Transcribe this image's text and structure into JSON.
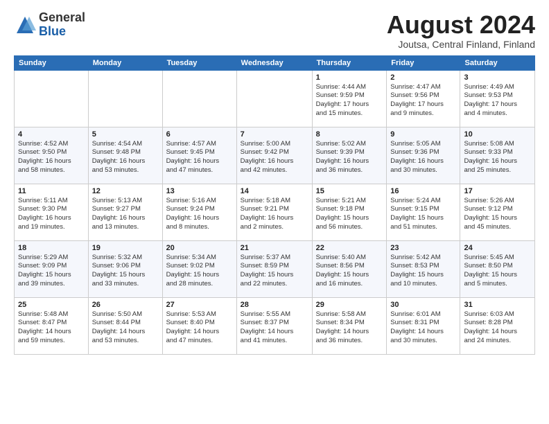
{
  "header": {
    "logo_general": "General",
    "logo_blue": "Blue",
    "month_title": "August 2024",
    "location": "Joutsa, Central Finland, Finland"
  },
  "days_of_week": [
    "Sunday",
    "Monday",
    "Tuesday",
    "Wednesday",
    "Thursday",
    "Friday",
    "Saturday"
  ],
  "weeks": [
    [
      {
        "day": "",
        "info": ""
      },
      {
        "day": "",
        "info": ""
      },
      {
        "day": "",
        "info": ""
      },
      {
        "day": "",
        "info": ""
      },
      {
        "day": "1",
        "info": "Sunrise: 4:44 AM\nSunset: 9:59 PM\nDaylight: 17 hours\nand 15 minutes."
      },
      {
        "day": "2",
        "info": "Sunrise: 4:47 AM\nSunset: 9:56 PM\nDaylight: 17 hours\nand 9 minutes."
      },
      {
        "day": "3",
        "info": "Sunrise: 4:49 AM\nSunset: 9:53 PM\nDaylight: 17 hours\nand 4 minutes."
      }
    ],
    [
      {
        "day": "4",
        "info": "Sunrise: 4:52 AM\nSunset: 9:50 PM\nDaylight: 16 hours\nand 58 minutes."
      },
      {
        "day": "5",
        "info": "Sunrise: 4:54 AM\nSunset: 9:48 PM\nDaylight: 16 hours\nand 53 minutes."
      },
      {
        "day": "6",
        "info": "Sunrise: 4:57 AM\nSunset: 9:45 PM\nDaylight: 16 hours\nand 47 minutes."
      },
      {
        "day": "7",
        "info": "Sunrise: 5:00 AM\nSunset: 9:42 PM\nDaylight: 16 hours\nand 42 minutes."
      },
      {
        "day": "8",
        "info": "Sunrise: 5:02 AM\nSunset: 9:39 PM\nDaylight: 16 hours\nand 36 minutes."
      },
      {
        "day": "9",
        "info": "Sunrise: 5:05 AM\nSunset: 9:36 PM\nDaylight: 16 hours\nand 30 minutes."
      },
      {
        "day": "10",
        "info": "Sunrise: 5:08 AM\nSunset: 9:33 PM\nDaylight: 16 hours\nand 25 minutes."
      }
    ],
    [
      {
        "day": "11",
        "info": "Sunrise: 5:11 AM\nSunset: 9:30 PM\nDaylight: 16 hours\nand 19 minutes."
      },
      {
        "day": "12",
        "info": "Sunrise: 5:13 AM\nSunset: 9:27 PM\nDaylight: 16 hours\nand 13 minutes."
      },
      {
        "day": "13",
        "info": "Sunrise: 5:16 AM\nSunset: 9:24 PM\nDaylight: 16 hours\nand 8 minutes."
      },
      {
        "day": "14",
        "info": "Sunrise: 5:18 AM\nSunset: 9:21 PM\nDaylight: 16 hours\nand 2 minutes."
      },
      {
        "day": "15",
        "info": "Sunrise: 5:21 AM\nSunset: 9:18 PM\nDaylight: 15 hours\nand 56 minutes."
      },
      {
        "day": "16",
        "info": "Sunrise: 5:24 AM\nSunset: 9:15 PM\nDaylight: 15 hours\nand 51 minutes."
      },
      {
        "day": "17",
        "info": "Sunrise: 5:26 AM\nSunset: 9:12 PM\nDaylight: 15 hours\nand 45 minutes."
      }
    ],
    [
      {
        "day": "18",
        "info": "Sunrise: 5:29 AM\nSunset: 9:09 PM\nDaylight: 15 hours\nand 39 minutes."
      },
      {
        "day": "19",
        "info": "Sunrise: 5:32 AM\nSunset: 9:06 PM\nDaylight: 15 hours\nand 33 minutes."
      },
      {
        "day": "20",
        "info": "Sunrise: 5:34 AM\nSunset: 9:02 PM\nDaylight: 15 hours\nand 28 minutes."
      },
      {
        "day": "21",
        "info": "Sunrise: 5:37 AM\nSunset: 8:59 PM\nDaylight: 15 hours\nand 22 minutes."
      },
      {
        "day": "22",
        "info": "Sunrise: 5:40 AM\nSunset: 8:56 PM\nDaylight: 15 hours\nand 16 minutes."
      },
      {
        "day": "23",
        "info": "Sunrise: 5:42 AM\nSunset: 8:53 PM\nDaylight: 15 hours\nand 10 minutes."
      },
      {
        "day": "24",
        "info": "Sunrise: 5:45 AM\nSunset: 8:50 PM\nDaylight: 15 hours\nand 5 minutes."
      }
    ],
    [
      {
        "day": "25",
        "info": "Sunrise: 5:48 AM\nSunset: 8:47 PM\nDaylight: 14 hours\nand 59 minutes."
      },
      {
        "day": "26",
        "info": "Sunrise: 5:50 AM\nSunset: 8:44 PM\nDaylight: 14 hours\nand 53 minutes."
      },
      {
        "day": "27",
        "info": "Sunrise: 5:53 AM\nSunset: 8:40 PM\nDaylight: 14 hours\nand 47 minutes."
      },
      {
        "day": "28",
        "info": "Sunrise: 5:55 AM\nSunset: 8:37 PM\nDaylight: 14 hours\nand 41 minutes."
      },
      {
        "day": "29",
        "info": "Sunrise: 5:58 AM\nSunset: 8:34 PM\nDaylight: 14 hours\nand 36 minutes."
      },
      {
        "day": "30",
        "info": "Sunrise: 6:01 AM\nSunset: 8:31 PM\nDaylight: 14 hours\nand 30 minutes."
      },
      {
        "day": "31",
        "info": "Sunrise: 6:03 AM\nSunset: 8:28 PM\nDaylight: 14 hours\nand 24 minutes."
      }
    ]
  ]
}
